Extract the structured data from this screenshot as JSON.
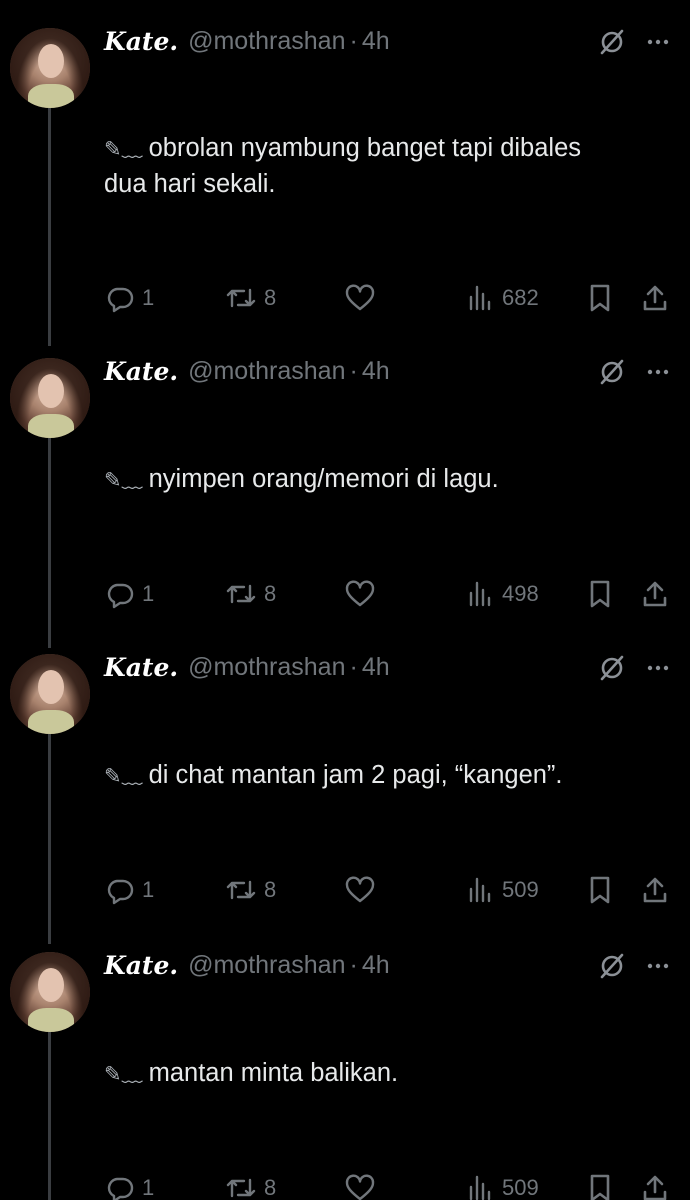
{
  "tweets": [
    {
      "display_name": "Kate.",
      "handle": "@mothrashan",
      "separator": "·",
      "time": "4h",
      "pencil": "✎﹏",
      "text_lines": [
        "obrolan nyambung banget tapi dibales",
        "dua hari sekali."
      ],
      "replies": "1",
      "retweets": "8",
      "views": "682"
    },
    {
      "display_name": "Kate.",
      "handle": "@mothrashan",
      "separator": "·",
      "time": "4h",
      "pencil": "✎﹏",
      "text_lines": [
        "nyimpen orang/memori di lagu."
      ],
      "replies": "1",
      "retweets": "8",
      "views": "498"
    },
    {
      "display_name": "Kate.",
      "handle": "@mothrashan",
      "separator": "·",
      "time": "4h",
      "pencil": "✎﹏",
      "text_lines": [
        "di chat mantan jam 2 pagi, “kangen”."
      ],
      "replies": "1",
      "retweets": "8",
      "views": "509"
    },
    {
      "display_name": "Kate.",
      "handle": "@mothrashan",
      "separator": "·",
      "time": "4h",
      "pencil": "✎﹏",
      "text_lines": [
        "mantan minta balikan."
      ],
      "replies": "1",
      "retweets": "8",
      "views": "509"
    }
  ],
  "icons": {
    "reply": "reply-icon",
    "retweet": "retweet-icon",
    "like": "heart-icon",
    "views": "views-icon",
    "bookmark": "bookmark-icon",
    "share": "share-icon",
    "grok": "grok-icon",
    "more": "more-icon"
  },
  "colors": {
    "background": "#000000",
    "text": "#e7e9ea",
    "muted": "#71767b",
    "thread_line": "#3a3d41"
  }
}
